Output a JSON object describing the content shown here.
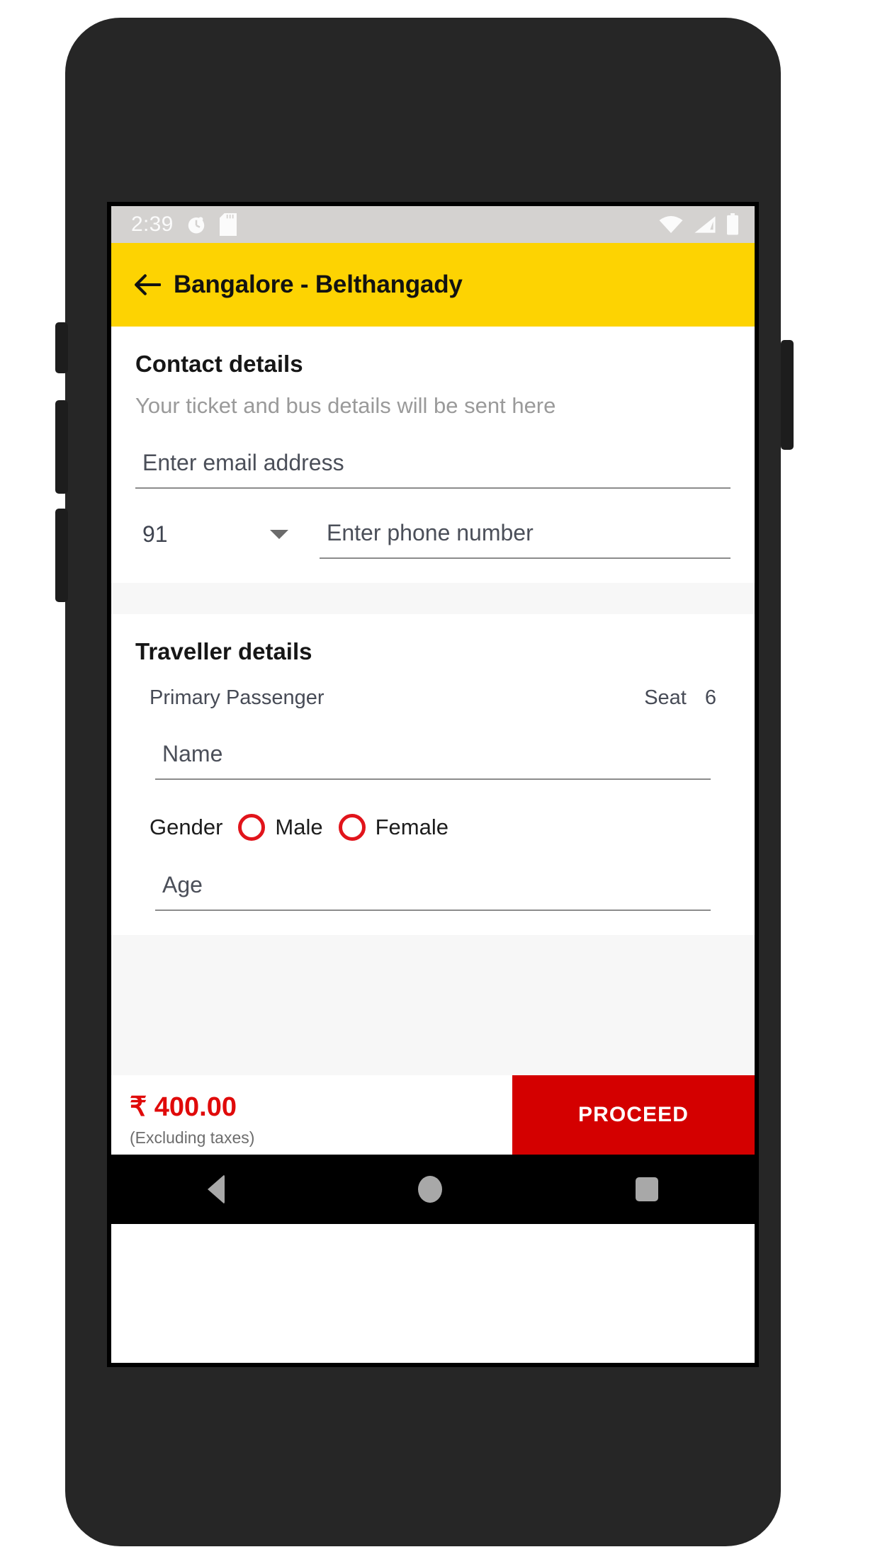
{
  "status_bar": {
    "time": "2:39",
    "left_icons": [
      "alarm-icon",
      "sd-card-icon"
    ],
    "right_icons": [
      "wifi-icon",
      "signal-icon",
      "battery-icon"
    ]
  },
  "app_bar": {
    "back_icon": "back-arrow-icon",
    "title": "Bangalore - Belthangady",
    "background": "#FDD302"
  },
  "contact": {
    "title": "Contact details",
    "subtitle": "Your ticket and bus details will be sent here",
    "email": {
      "value": "",
      "placeholder": "Enter email address"
    },
    "country_code": {
      "value": "91"
    },
    "phone": {
      "value": "",
      "placeholder": "Enter phone number"
    }
  },
  "traveller": {
    "title": "Traveller details",
    "passenger_label": "Primary Passenger",
    "seat_label": "Seat",
    "seat_number": "6",
    "name": {
      "value": "",
      "placeholder": "Name"
    },
    "gender": {
      "label": "Gender",
      "options": [
        {
          "label": "Male",
          "selected": false
        },
        {
          "label": "Female",
          "selected": false
        }
      ],
      "radio_color": "#E1141B"
    },
    "age": {
      "value": "",
      "placeholder": "Age"
    }
  },
  "bottom_bar": {
    "price": "₹ 400.00",
    "price_note": "(Excluding taxes)",
    "price_color": "#E00A0A",
    "proceed_label": "PROCEED",
    "proceed_color": "#D40000"
  },
  "nav_bar": {
    "items": [
      "back-nav-icon",
      "home-nav-icon",
      "recents-nav-icon"
    ]
  }
}
